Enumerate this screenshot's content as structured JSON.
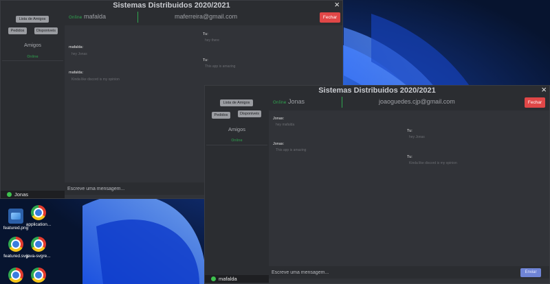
{
  "desktop": {
    "icons": [
      {
        "label": "featured.png",
        "icon": "png-file-icon"
      },
      {
        "label": "application...",
        "icon": "chrome-icon"
      },
      {
        "label": "featured.svg",
        "icon": "chrome-icon"
      },
      {
        "label": "java-svgre...",
        "icon": "chrome-icon"
      },
      {
        "label": "",
        "icon": "chrome-icon"
      },
      {
        "label": "",
        "icon": "chrome-icon"
      }
    ]
  },
  "window1": {
    "title": "Sistemas Distribuidos 2020/2021",
    "close_icon": "×",
    "sidebar": {
      "btn_lista": "Lista de Amigos",
      "btn_pedidos": "Pedidos",
      "btn_disponiveis": "Disponiveis",
      "amigos_label": "Amigos",
      "amigos_status": "Online",
      "current_user": "Jonas"
    },
    "header": {
      "status": "Online",
      "name": "mafalda",
      "email": "maferreira@gmail.com",
      "fechar": "Fechar"
    },
    "messages": [
      {
        "sender": "Tu:",
        "text": "hey there",
        "side": "right"
      },
      {
        "sender": "mafalda:",
        "text": "hey Jonas",
        "side": "left"
      },
      {
        "sender": "Tu:",
        "text": "This app is amazing",
        "side": "right"
      },
      {
        "sender": "mafalda:",
        "text": "Kinda like discord is my opinion",
        "side": "left"
      }
    ],
    "compose_placeholder": "Escreve uma mensagem...",
    "enviar": "Enviar"
  },
  "window2": {
    "title": "Sistemas Distribuidos 2020/2021",
    "close_icon": "×",
    "sidebar": {
      "btn_lista": "Lista de Amigos",
      "btn_pedidos": "Pedidos",
      "btn_disponiveis": "Disponiveis",
      "amigos_label": "Amigos",
      "amigos_status": "Online",
      "current_user": "mafalda"
    },
    "header": {
      "status": "Online",
      "name": "Jonas",
      "email": "joaoguedes.cjp@gmail.com",
      "fechar": "Fechar"
    },
    "messages": [
      {
        "sender": "Jonas:",
        "text": "hey mafalda",
        "side": "left"
      },
      {
        "sender": "Tu:",
        "text": "hey Jonas",
        "side": "right"
      },
      {
        "sender": "Jonas:",
        "text": "This app is amazing",
        "side": "left"
      },
      {
        "sender": "Tu:",
        "text": "Kinda like discord is my opinion",
        "side": "right"
      }
    ],
    "compose_placeholder": "Escreve uma mensagem...",
    "enviar": "Enviar"
  },
  "colors": {
    "online": "#2fa84f",
    "fechar": "#e04747",
    "enviar": "#6f84d6",
    "window_bg": "#2b2d31",
    "chat_bg": "#313338"
  }
}
